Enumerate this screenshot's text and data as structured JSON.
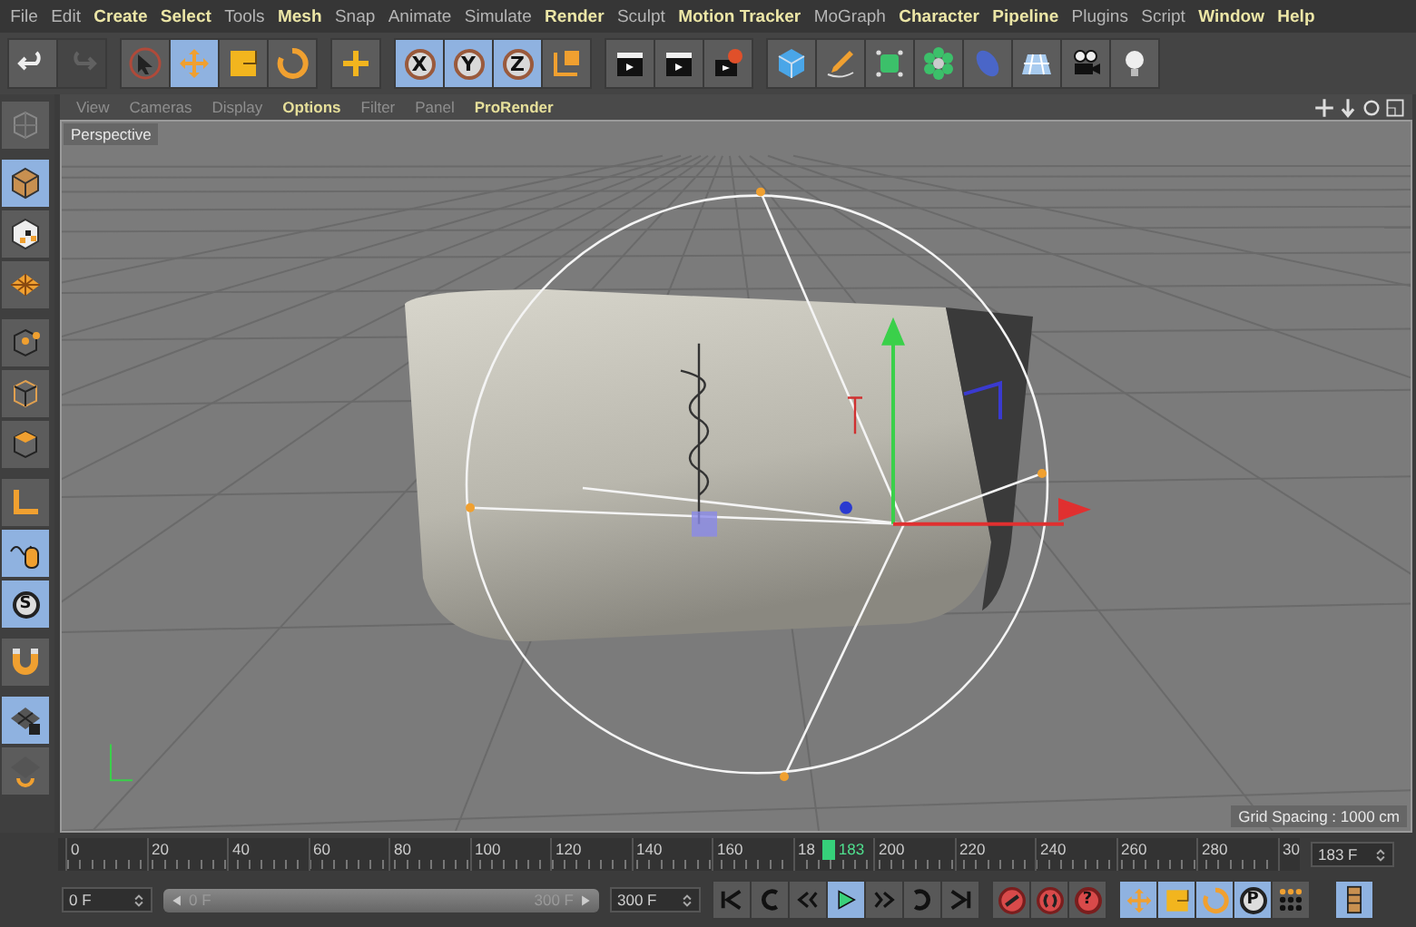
{
  "menu": [
    {
      "label": "File",
      "highlighted": false
    },
    {
      "label": "Edit",
      "highlighted": false
    },
    {
      "label": "Create",
      "highlighted": true
    },
    {
      "label": "Select",
      "highlighted": true
    },
    {
      "label": "Tools",
      "highlighted": false
    },
    {
      "label": "Mesh",
      "highlighted": true
    },
    {
      "label": "Snap",
      "highlighted": false
    },
    {
      "label": "Animate",
      "highlighted": false
    },
    {
      "label": "Simulate",
      "highlighted": false
    },
    {
      "label": "Render",
      "highlighted": true
    },
    {
      "label": "Sculpt",
      "highlighted": false
    },
    {
      "label": "Motion Tracker",
      "highlighted": true
    },
    {
      "label": "MoGraph",
      "highlighted": false
    },
    {
      "label": "Character",
      "highlighted": true
    },
    {
      "label": "Pipeline",
      "highlighted": true
    },
    {
      "label": "Plugins",
      "highlighted": false
    },
    {
      "label": "Script",
      "highlighted": false
    },
    {
      "label": "Window",
      "highlighted": true
    },
    {
      "label": "Help",
      "highlighted": true
    }
  ],
  "toolbar_groups": [
    {
      "buttons": [
        {
          "kind": "undo",
          "selected": false,
          "disabled": false
        },
        {
          "kind": "redo",
          "selected": false,
          "disabled": true
        }
      ]
    },
    {
      "buttons": [
        {
          "kind": "pointer",
          "selected": false,
          "disabled": false
        },
        {
          "kind": "move",
          "selected": true,
          "disabled": false
        },
        {
          "kind": "scale",
          "selected": false,
          "disabled": false
        },
        {
          "kind": "rotate",
          "selected": false,
          "disabled": false
        }
      ]
    },
    {
      "buttons": [
        {
          "kind": "add",
          "selected": false,
          "disabled": false
        }
      ]
    },
    {
      "buttons": [
        {
          "kind": "letter",
          "label": "X",
          "selected": true,
          "disabled": false
        },
        {
          "kind": "letter",
          "label": "Y",
          "selected": true,
          "disabled": false
        },
        {
          "kind": "letter",
          "label": "Z",
          "selected": true,
          "disabled": false
        },
        {
          "kind": "coords",
          "selected": false,
          "disabled": false
        }
      ]
    },
    {
      "buttons": [
        {
          "kind": "clapper",
          "selected": false,
          "disabled": false
        },
        {
          "kind": "clapper",
          "selected": false,
          "disabled": false
        },
        {
          "kind": "clapper-gear",
          "selected": false,
          "disabled": false
        }
      ]
    },
    {
      "buttons": [
        {
          "kind": "cube",
          "selected": false,
          "disabled": false
        },
        {
          "kind": "pen",
          "selected": false,
          "disabled": false
        },
        {
          "kind": "subdiv",
          "selected": false,
          "disabled": false
        },
        {
          "kind": "cluster",
          "selected": false,
          "disabled": false
        },
        {
          "kind": "capsule",
          "selected": false,
          "disabled": false
        },
        {
          "kind": "floor",
          "selected": false,
          "disabled": false
        },
        {
          "kind": "camera",
          "selected": false,
          "disabled": false
        },
        {
          "kind": "bulb",
          "selected": false,
          "disabled": false
        }
      ]
    }
  ],
  "left_groups": [
    {
      "buttons": [
        {
          "kind": "gridcube",
          "selected": false
        }
      ]
    },
    {
      "buttons": [
        {
          "kind": "model",
          "selected": true
        },
        {
          "kind": "checker",
          "selected": false
        },
        {
          "kind": "plane",
          "selected": false
        }
      ]
    },
    {
      "buttons": [
        {
          "kind": "points",
          "selected": false
        },
        {
          "kind": "edges",
          "selected": false
        },
        {
          "kind": "faces",
          "selected": false
        }
      ]
    },
    {
      "buttons": [
        {
          "kind": "axis",
          "selected": false
        },
        {
          "kind": "mouse",
          "selected": true
        },
        {
          "kind": "letter",
          "label": "S",
          "selected": true
        }
      ]
    },
    {
      "buttons": [
        {
          "kind": "magnet",
          "selected": false
        }
      ]
    },
    {
      "buttons": [
        {
          "kind": "gridlock",
          "selected": true
        },
        {
          "kind": "gridrotate",
          "selected": false
        }
      ]
    }
  ],
  "viewport_menu": [
    {
      "label": "View",
      "highlighted": false
    },
    {
      "label": "Cameras",
      "highlighted": false
    },
    {
      "label": "Display",
      "highlighted": false
    },
    {
      "label": "Options",
      "highlighted": true
    },
    {
      "label": "Filter",
      "highlighted": false
    },
    {
      "label": "Panel",
      "highlighted": false
    },
    {
      "label": "ProRender",
      "highlighted": true
    }
  ],
  "viewport": {
    "camera": "Perspective",
    "grid_spacing": "Grid Spacing : 1000 cm"
  },
  "timeline": {
    "ticks": [
      "0",
      "20",
      "40",
      "60",
      "80",
      "100",
      "120",
      "140",
      "160",
      "18",
      "200",
      "220",
      "240",
      "260",
      "280",
      "30"
    ],
    "playhead": {
      "label": "183",
      "level": 0.61
    },
    "current_frame": "183 F"
  },
  "controls": {
    "start_field": "0 F",
    "range_start": "0 F",
    "range_end": "300 F",
    "range_slider": {
      "level": 1
    },
    "end_field": "300 F",
    "playback": [
      {
        "kind": "first",
        "selected": false
      },
      {
        "kind": "prevkey",
        "selected": false
      },
      {
        "kind": "prev",
        "selected": false
      },
      {
        "kind": "play",
        "selected": true
      },
      {
        "kind": "next",
        "selected": false
      },
      {
        "kind": "nextkey",
        "selected": false
      },
      {
        "kind": "last",
        "selected": false
      }
    ],
    "keys": [
      {
        "kind": "record"
      },
      {
        "kind": "auto"
      },
      {
        "kind": "letter",
        "label": "?"
      }
    ],
    "modes": [
      {
        "kind": "move",
        "selected": true
      },
      {
        "kind": "scale",
        "selected": true
      },
      {
        "kind": "rotate",
        "selected": true
      },
      {
        "kind": "letter",
        "label": "P",
        "selected": true
      },
      {
        "kind": "dots",
        "selected": false
      },
      {
        "kind": "film",
        "selected": true
      }
    ]
  }
}
